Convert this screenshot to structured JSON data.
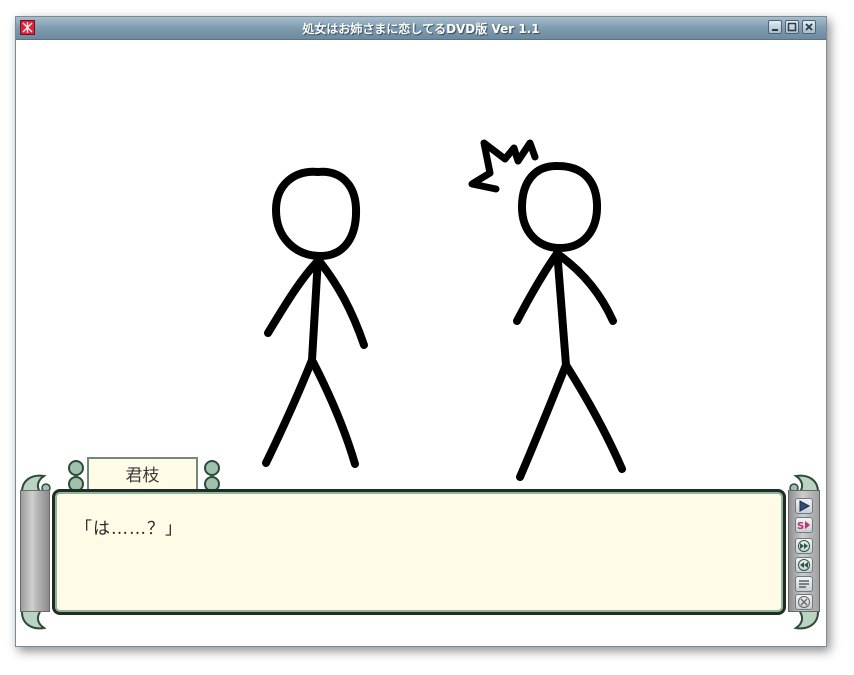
{
  "window": {
    "title": "処女はお姉さまに恋してるDVD版 Ver 1.1",
    "title_bar_color": "#7f9bb0",
    "controls": [
      {
        "name": "minimize",
        "icon": "minimize-icon"
      },
      {
        "name": "maximize",
        "icon": "maximize-icon"
      },
      {
        "name": "close",
        "icon": "close-icon"
      }
    ]
  },
  "scene": {
    "characters": [
      "stick-figure-left",
      "stick-figure-right-surprised"
    ],
    "effect_icon": "surprise-mark-icon"
  },
  "message": {
    "speaker": "君枝",
    "text": "「は……？」",
    "frame_color": "#1e2e24",
    "background_color": "#fffbe6"
  },
  "controls": [
    {
      "name": "play",
      "icon": "play-icon"
    },
    {
      "name": "skip",
      "icon": "skip-icon",
      "color": "#c0306a"
    },
    {
      "name": "fast-forward",
      "icon": "fast-forward-icon"
    },
    {
      "name": "rewind",
      "icon": "rewind-icon"
    },
    {
      "name": "log",
      "icon": "log-icon"
    },
    {
      "name": "close",
      "icon": "x-icon"
    }
  ]
}
